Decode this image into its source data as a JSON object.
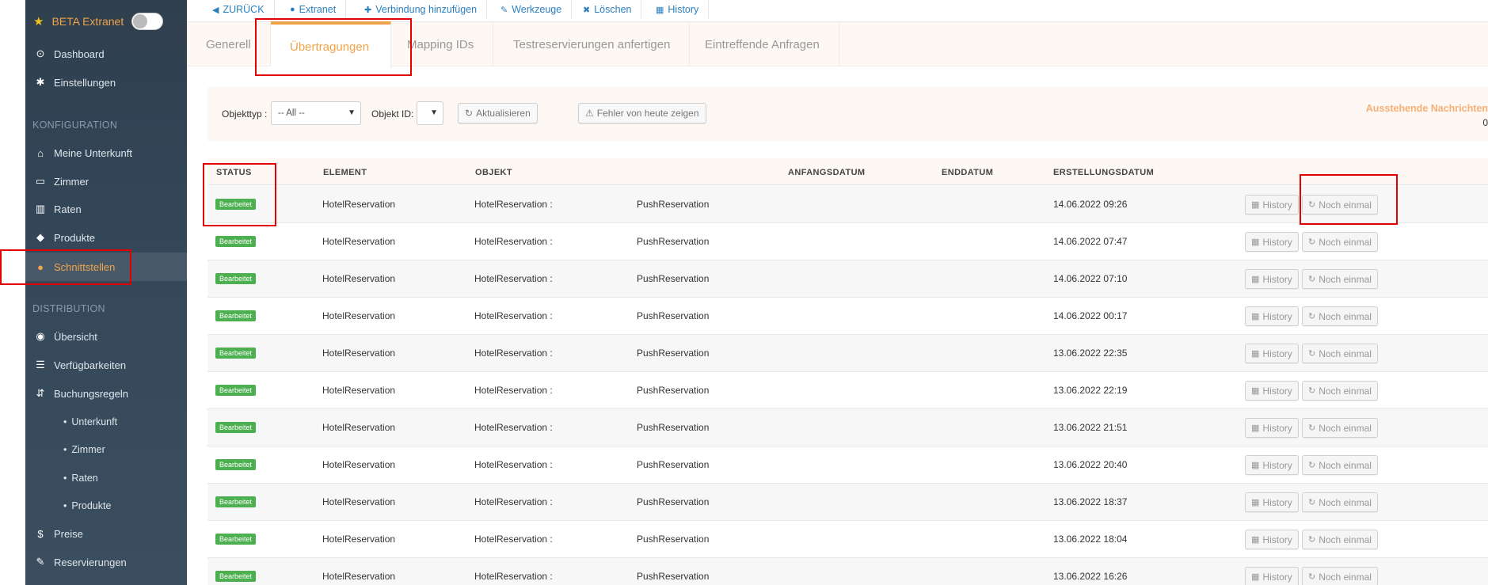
{
  "sidebar": {
    "beta_label": "BETA Extranet",
    "items_top": [
      {
        "label": "Dashboard",
        "icon": "dashboard-icon"
      },
      {
        "label": "Einstellungen",
        "icon": "gear-icon"
      }
    ],
    "section_konfiguration": "KONFIGURATION",
    "items_config": [
      {
        "label": "Meine Unterkunft",
        "icon": "home-icon"
      },
      {
        "label": "Zimmer",
        "icon": "bed-icon"
      },
      {
        "label": "Raten",
        "icon": "barcode-icon"
      },
      {
        "label": "Produkte",
        "icon": "tag-icon"
      },
      {
        "label": "Schnittstellen",
        "icon": "globe-icon"
      }
    ],
    "section_distribution": "DISTRIBUTION",
    "items_distribution": [
      {
        "label": "Übersicht",
        "icon": "eye-icon"
      },
      {
        "label": "Verfügbarkeiten",
        "icon": "list-icon"
      },
      {
        "label": "Buchungsregeln",
        "icon": "sort-icon"
      }
    ],
    "sub_items": [
      "Unterkunft",
      "Zimmer",
      "Raten",
      "Produkte"
    ],
    "items_bottom": [
      {
        "label": "Preise",
        "icon": "dollar-icon"
      },
      {
        "label": "Reservierungen",
        "icon": "pin-icon"
      }
    ],
    "active_color": "#f0a44a"
  },
  "toolbar": {
    "back": "ZURÜCK",
    "extranet": "Extranet",
    "add_connection": "Verbindung hinzufügen",
    "tools": "Werkzeuge",
    "delete": "Löschen",
    "history": "History"
  },
  "tabs": [
    "Generell",
    "Übertragungen",
    "Mapping IDs",
    "Testreservierungen anfertigen",
    "Eintreffende Anfragen"
  ],
  "filters": {
    "objekttyp_label": "Objekttyp :",
    "objekttyp_value": "-- All --",
    "objekt_id_label": "Objekt ID:",
    "refresh": "Aktualisieren",
    "errors_today": "Fehler von heute zeigen",
    "pending_title": "Ausstehende Nachrichten",
    "pending_count": "0"
  },
  "table": {
    "headers": [
      "STATUS",
      "ELEMENT",
      "OBJEKT",
      "ANFANGSDATUM",
      "ENDDATUM",
      "ERSTELLUNGSDATUM"
    ],
    "history_label": "History",
    "retry_label": "Noch einmal",
    "rows": [
      {
        "status": "Bearbeitet",
        "element": "HotelReservation",
        "objekt": "HotelReservation :",
        "type": "PushReservation",
        "created": "14.06.2022 09:26"
      },
      {
        "status": "Bearbeitet",
        "element": "HotelReservation",
        "objekt": "HotelReservation :",
        "type": "PushReservation",
        "created": "14.06.2022 07:47"
      },
      {
        "status": "Bearbeitet",
        "element": "HotelReservation",
        "objekt": "HotelReservation :",
        "type": "PushReservation",
        "created": "14.06.2022 07:10"
      },
      {
        "status": "Bearbeitet",
        "element": "HotelReservation",
        "objekt": "HotelReservation :",
        "type": "PushReservation",
        "created": "14.06.2022 00:17"
      },
      {
        "status": "Bearbeitet",
        "element": "HotelReservation",
        "objekt": "HotelReservation :",
        "type": "PushReservation",
        "created": "13.06.2022 22:35"
      },
      {
        "status": "Bearbeitet",
        "element": "HotelReservation",
        "objekt": "HotelReservation :",
        "type": "PushReservation",
        "created": "13.06.2022 22:19"
      },
      {
        "status": "Bearbeitet",
        "element": "HotelReservation",
        "objekt": "HotelReservation :",
        "type": "PushReservation",
        "created": "13.06.2022 21:51"
      },
      {
        "status": "Bearbeitet",
        "element": "HotelReservation",
        "objekt": "HotelReservation :",
        "type": "PushReservation",
        "created": "13.06.2022 20:40"
      },
      {
        "status": "Bearbeitet",
        "element": "HotelReservation",
        "objekt": "HotelReservation :",
        "type": "PushReservation",
        "created": "13.06.2022 18:37"
      },
      {
        "status": "Bearbeitet",
        "element": "HotelReservation",
        "objekt": "HotelReservation :",
        "type": "PushReservation",
        "created": "13.06.2022 18:04"
      },
      {
        "status": "Bearbeitet",
        "element": "HotelReservation",
        "objekt": "HotelReservation :",
        "type": "PushReservation",
        "created": "13.06.2022 16:26"
      }
    ],
    "status_color": "#4caf50"
  },
  "annotation_color": "#e30000"
}
